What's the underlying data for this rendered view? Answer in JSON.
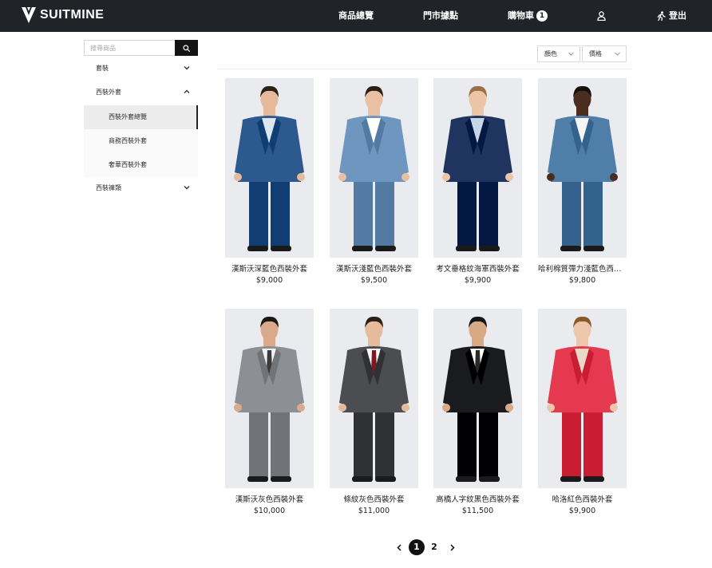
{
  "brand": {
    "name": "SUITMINE"
  },
  "nav": {
    "products": "商品總覽",
    "stores": "門市據點",
    "cart": "購物車",
    "cart_count": "1",
    "logout": "登出"
  },
  "search": {
    "placeholder": "搜尋商品"
  },
  "sidebar": {
    "categories": [
      {
        "label": "套裝",
        "expanded": false
      },
      {
        "label": "西裝外套",
        "expanded": true,
        "children": [
          {
            "label": "西裝外套總覽",
            "active": true
          },
          {
            "label": "商務西裝外套",
            "active": false
          },
          {
            "label": "奢華西裝外套",
            "active": false
          }
        ]
      },
      {
        "label": "西裝褲類",
        "expanded": false
      }
    ]
  },
  "filters": {
    "color": "顏色",
    "price": "價格"
  },
  "products": [
    {
      "name": "漢斯沃深藍色西裝外套",
      "price": "$9,000",
      "suit": "#2d5a8e",
      "shirt": "#dde6f0",
      "tie": "none",
      "skin": "#e5b99a",
      "hair": "#2a1f17"
    },
    {
      "name": "漢斯沃淺藍色西裝外套",
      "price": "$9,500",
      "suit": "#6e96be",
      "shirt": "#ffffff",
      "tie": "none",
      "skin": "#e9c0a2",
      "hair": "#2a1f17"
    },
    {
      "name": "考文垂格紋海軍西裝外套",
      "price": "$9,900",
      "suit": "#1f3560",
      "shirt": "#c6d6e8",
      "tie": "none",
      "skin": "#ecc4a6",
      "hair": "#9a7048"
    },
    {
      "name": "哈利棉質彈力淺藍色西裝外套",
      "price": "$9,800",
      "suit": "#4f7fa9",
      "shirt": "#f5f5f5",
      "tie": "none",
      "skin": "#4a2d1f",
      "hair": "#150e0a"
    },
    {
      "name": "漢斯沃灰色西裝外套",
      "price": "$10,000",
      "suit": "#8c8f94",
      "shirt": "#f2f2f2",
      "tie": "#3b3b3b",
      "skin": "#d9a98a",
      "hair": "#1e1712"
    },
    {
      "name": "條紋灰色西裝外套",
      "price": "$11,000",
      "suit": "#4b4d51",
      "shirt": "#f8f8f8",
      "tie": "#7a1a25",
      "skin": "#e6bb9c",
      "hair": "#2a1f17"
    },
    {
      "name": "高橋人字紋黑色西裝外套",
      "price": "$11,500",
      "suit": "#1a1b1e",
      "shirt": "#ffffff",
      "tie": "#2a2a2a",
      "skin": "#d8a985",
      "hair": "#151515"
    },
    {
      "name": "哈洛紅色西裝外套",
      "price": "$9,900",
      "suit": "#e5394f",
      "shirt": "#ead9c6",
      "tie": "none",
      "skin": "#ecc7ab",
      "hair": "#8b5a2b"
    }
  ],
  "pagination": {
    "pages": [
      "1",
      "2"
    ],
    "current": "1"
  },
  "colors": {
    "header_bg": "#202428",
    "accent": "#111111"
  }
}
